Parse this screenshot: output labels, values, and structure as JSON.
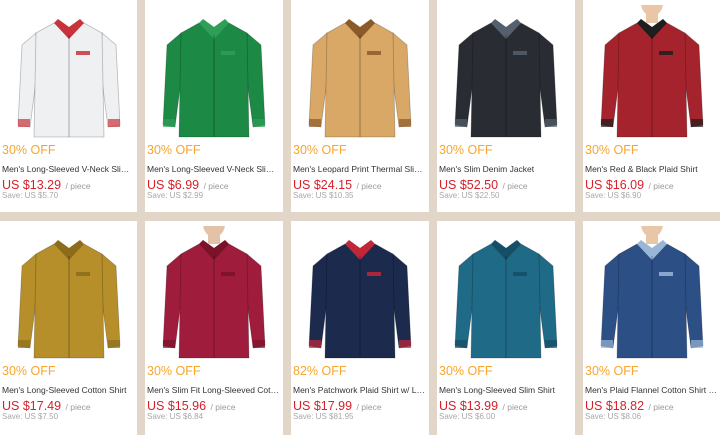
{
  "products": [
    {
      "discount": "30% OFF",
      "title": "Men's Long-Sleeved V-Neck Slim Fit T-Shirt",
      "price": "US $13.29",
      "unit": "/ piece",
      "save": "Save: US $5.70",
      "image_icon": "white-dotted-polo-shirt-icon",
      "shirt_color": "#eef0f2",
      "accent_color": "#c8323a",
      "skin": "#e4c2a8"
    },
    {
      "discount": "30% OFF",
      "title": "Men's Long-Sleeved V-Neck Slim Shirt",
      "price": "US $6.99",
      "unit": "/ piece",
      "save": "Save: US $2.99",
      "image_icon": "green-long-sleeve-shirt-icon",
      "shirt_color": "#1c8a45",
      "accent_color": "#2f9e58",
      "skin": "#e4c2a8"
    },
    {
      "discount": "30% OFF",
      "title": "Men's Leopard Print Thermal Slim Fit Shirt",
      "price": "US $24.15",
      "unit": "/ piece",
      "save": "Save: US $10.35",
      "image_icon": "leopard-print-shirt-icon",
      "shirt_color": "#d9a867",
      "accent_color": "#8b5a2b",
      "skin": "#e4c2a8"
    },
    {
      "discount": "30% OFF",
      "title": "Men's Slim Denim Jacket",
      "price": "US $52.50",
      "unit": "/ piece",
      "save": "Save: US $22.50",
      "image_icon": "denim-jacket-icon",
      "shirt_color": "#2a2c33",
      "accent_color": "#55606e",
      "skin": "#e4c2a8"
    },
    {
      "discount": "30% OFF",
      "title": "Men's Red & Black Plaid Shirt",
      "price": "US $16.09",
      "unit": "/ piece",
      "save": "Save: US $6.90",
      "image_icon": "red-black-plaid-shirt-icon",
      "shirt_color": "#a4232c",
      "accent_color": "#1e1e1e",
      "skin": "#e8c6a6"
    },
    {
      "discount": "30% OFF",
      "title": "Men's Long-Sleeved Cotton Shirt",
      "price": "US $17.49",
      "unit": "/ piece",
      "save": "Save: US $7.50",
      "image_icon": "mustard-cotton-shirt-icon",
      "shirt_color": "#b68f2a",
      "accent_color": "#8c6c1a",
      "skin": "#e4c2a8"
    },
    {
      "discount": "30% OFF",
      "title": "Men's Slim Fit Long-Sleeved Cotton Shirt",
      "price": "US $15.96",
      "unit": "/ piece",
      "save": "Save: US $6.84",
      "image_icon": "burgundy-shirt-icon",
      "shirt_color": "#a01c3c",
      "accent_color": "#7a1229",
      "skin": "#e4c2a8"
    },
    {
      "discount": "82% OFF",
      "title": "Men's Patchwork Plaid Shirt w/ Long Sleeves",
      "price": "US $17.99",
      "unit": "/ piece",
      "save": "Save: US $81.95",
      "image_icon": "navy-patchwork-shirt-icon",
      "shirt_color": "#1b2a4d",
      "accent_color": "#c0283a",
      "skin": "#e4c2a8"
    },
    {
      "discount": "30% OFF",
      "title": "Men's Long-Sleeved Slim Shirt",
      "price": "US $13.99",
      "unit": "/ piece",
      "save": "Save: US $6.00",
      "image_icon": "teal-slim-shirt-icon",
      "shirt_color": "#1f6a86",
      "accent_color": "#154f66",
      "skin": "#e4c2a8"
    },
    {
      "discount": "30% OFF",
      "title": "Men's Plaid Flannel Cotton Shirt w/ Pocket",
      "price": "US $18.82",
      "unit": "/ piece",
      "save": "Save: US $8.06",
      "image_icon": "blue-plaid-flannel-shirt-icon",
      "shirt_color": "#2c4f86",
      "accent_color": "#9ab6d6",
      "skin": "#e8c6a6"
    }
  ]
}
